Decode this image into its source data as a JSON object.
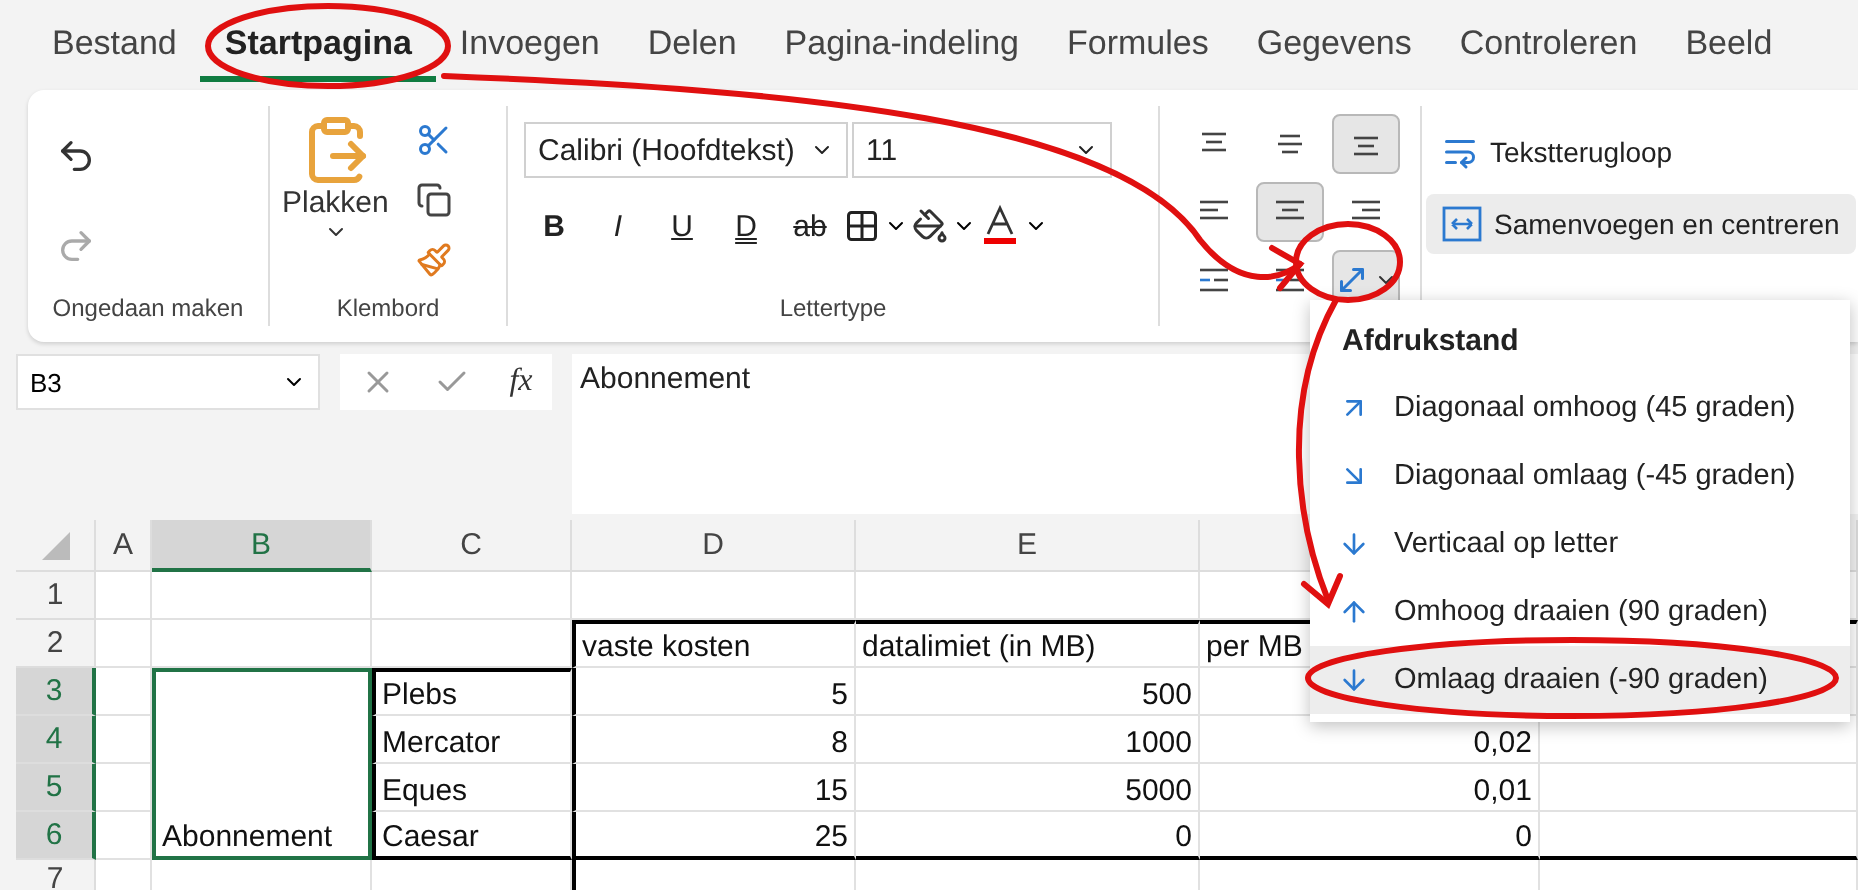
{
  "tabs": [
    {
      "label": "Bestand",
      "selected": false
    },
    {
      "label": "Startpagina",
      "selected": true
    },
    {
      "label": "Invoegen",
      "selected": false
    },
    {
      "label": "Delen",
      "selected": false
    },
    {
      "label": "Pagina-indeling",
      "selected": false
    },
    {
      "label": "Formules",
      "selected": false
    },
    {
      "label": "Gegevens",
      "selected": false
    },
    {
      "label": "Controleren",
      "selected": false
    },
    {
      "label": "Beeld",
      "selected": false
    }
  ],
  "undo_group": {
    "label": "Ongedaan maken"
  },
  "clipboard_group": {
    "paste": "Plakken",
    "label": "Klembord"
  },
  "font_group": {
    "font_name": "Calibri (Hoofdtekst)",
    "font_size": "11",
    "label": "Lettertype",
    "style_buttons": [
      {
        "kind": "bold",
        "text": "B"
      },
      {
        "kind": "italic",
        "text": "I"
      },
      {
        "kind": "underline",
        "text": "U"
      },
      {
        "kind": "double",
        "text": "D"
      },
      {
        "kind": "strike",
        "text": "ab"
      }
    ]
  },
  "alignment_buttons": [
    {
      "kind": "top",
      "selected": false
    },
    {
      "kind": "middle",
      "selected": false
    },
    {
      "kind": "bottom",
      "selected": true
    },
    {
      "kind": "left",
      "selected": false
    },
    {
      "kind": "center",
      "selected": true
    },
    {
      "kind": "right",
      "selected": false
    },
    {
      "kind": "outdent",
      "selected": false
    },
    {
      "kind": "indent",
      "selected": false
    },
    {
      "kind": "orientation",
      "selected": true
    }
  ],
  "wrap_button": "Tekstterugloop",
  "merge_button": "Samenvoegen en centreren",
  "name_box": "B3",
  "fx_label": "fx",
  "formula": "Abonnement",
  "columns": [
    {
      "label": "A",
      "selected": false
    },
    {
      "label": "B",
      "selected": true
    },
    {
      "label": "C",
      "selected": false
    },
    {
      "label": "D",
      "selected": false
    },
    {
      "label": "E",
      "selected": false
    }
  ],
  "rows": [
    {
      "header": "1",
      "selected": false,
      "cells": [
        null,
        null,
        null,
        null,
        null,
        null,
        null
      ]
    },
    {
      "header": "2",
      "selected": false,
      "cells": [
        null,
        null,
        null,
        "vaste kosten",
        "datalimiet (in MB)",
        "per MB",
        null
      ]
    },
    {
      "header": "3",
      "selected": true,
      "cells": [
        null,
        "Abonnement",
        "Plebs",
        "5",
        "500",
        null,
        null
      ]
    },
    {
      "header": "4",
      "selected": true,
      "cells": [
        null,
        null,
        "Mercator",
        "8",
        "1000",
        "0,02",
        null
      ]
    },
    {
      "header": "5",
      "selected": true,
      "cells": [
        null,
        null,
        "Eques",
        "15",
        "5000",
        "0,01",
        null
      ]
    },
    {
      "header": "6",
      "selected": true,
      "cells": [
        null,
        null,
        "Caesar",
        "25",
        "0",
        "0",
        null
      ]
    },
    {
      "header": "7",
      "selected": false,
      "cells": [
        null,
        null,
        null,
        null,
        null,
        null,
        null
      ]
    }
  ],
  "orientation_menu": {
    "title": "Afdrukstand",
    "items": [
      {
        "kind": "diag-up",
        "label": "Diagonaal omhoog (45 graden)",
        "selected": false
      },
      {
        "kind": "diag-down",
        "label": "Diagonaal omlaag (-45 graden)",
        "selected": false
      },
      {
        "kind": "vertical",
        "label": "Verticaal op letter",
        "selected": false
      },
      {
        "kind": "up",
        "label": "Omhoog draaien (90 graden)",
        "selected": false
      },
      {
        "kind": "down",
        "label": "Omlaag draaien (-90 graden)",
        "selected": true
      }
    ]
  }
}
